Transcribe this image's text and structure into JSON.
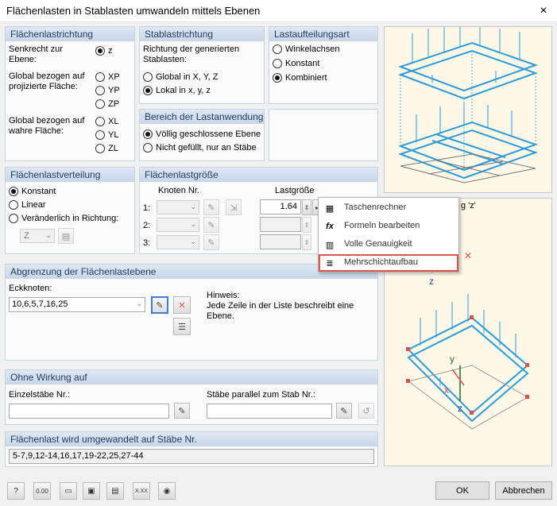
{
  "window": {
    "title": "Flächenlasten in Stablasten umwandeln mittels Ebenen",
    "close_icon": "×"
  },
  "flaechenlastrichtung": {
    "title": "Flächenlastrichtung",
    "senkrecht_label": "Senkrecht zur\nEbene:",
    "projiziert_label": "Global bezogen auf\nprojizierte Fläche:",
    "wahr_label": "Global bezogen auf\nwahre Fläche:",
    "options": [
      "z",
      "XP",
      "YP",
      "ZP",
      "XL",
      "YL",
      "ZL"
    ],
    "selected": "z"
  },
  "stablastrichtung": {
    "title": "Stablastrichtung",
    "desc": "Richtung der generierten\nStablasten:",
    "options": [
      "Global in X, Y, Z",
      "Lokal in x, y, z"
    ],
    "selected": "Lokal in x, y, z"
  },
  "lastaufteilungsart": {
    "title": "Lastaufteilungsart",
    "options": [
      "Winkelachsen",
      "Konstant",
      "Kombiniert"
    ],
    "selected": "Kombiniert"
  },
  "bereich": {
    "title": "Bereich der Lastanwendung",
    "options": [
      "Völlig geschlossene Ebene",
      "Nicht gefüllt, nur an Stäbe"
    ],
    "selected": "Völlig geschlossene Ebene"
  },
  "verteilung": {
    "title": "Flächenlastverteilung",
    "options": [
      "Konstant",
      "Linear",
      "Veränderlich in Richtung:"
    ],
    "selected": "Konstant",
    "richtung_value": "Z"
  },
  "groesse": {
    "title": "Flächenlastgröße",
    "col_knoten": "Knoten Nr.",
    "col_last": "Lastgröße",
    "rows": [
      {
        "label": "1:",
        "value": "1.64"
      },
      {
        "label": "2:",
        "value": ""
      },
      {
        "label": "3:",
        "value": ""
      }
    ]
  },
  "context_menu": {
    "items": [
      "Taschenrechner",
      "Formeln bearbeiten",
      "Volle Genauigkeit",
      "Mehrschichtaufbau"
    ],
    "highlighted": "Mehrschichtaufbau",
    "overlap_text": "g 'z'"
  },
  "abgrenzung": {
    "title": "Abgrenzung der Flächenlastebene",
    "eckknoten_label": "Eckknoten:",
    "eckknoten_value": "10,6,5,7,16,25",
    "hinweis_title": "Hinweis:",
    "hinweis_text": "Jede Zeile in der Liste beschreibt eine\nEbene."
  },
  "ohne_wirkung": {
    "title": "Ohne Wirkung auf",
    "einzelstaebe_label": "Einzelstäbe Nr.:",
    "einzelstaebe_value": "",
    "parallel_label": "Stäbe parallel zum Stab Nr.:",
    "parallel_value": ""
  },
  "umgewandelt": {
    "title": "Flächenlast wird umgewandelt auf Stäbe Nr.",
    "value": "5-7,9,12-14,16,17,19-22,25,27-44"
  },
  "preview": {
    "axis_z": "z",
    "axis_y": "y",
    "axis_x": "x"
  },
  "footer": {
    "ok_label": "OK",
    "cancel_label": "Abbrechen",
    "numeric_label": "0.00",
    "xxx_label": "X.XX"
  },
  "colors": {
    "structure_blue": "#2f9ad6",
    "highlight_red": "#d9534f",
    "header_gradient_top": "#dfe8f3"
  }
}
